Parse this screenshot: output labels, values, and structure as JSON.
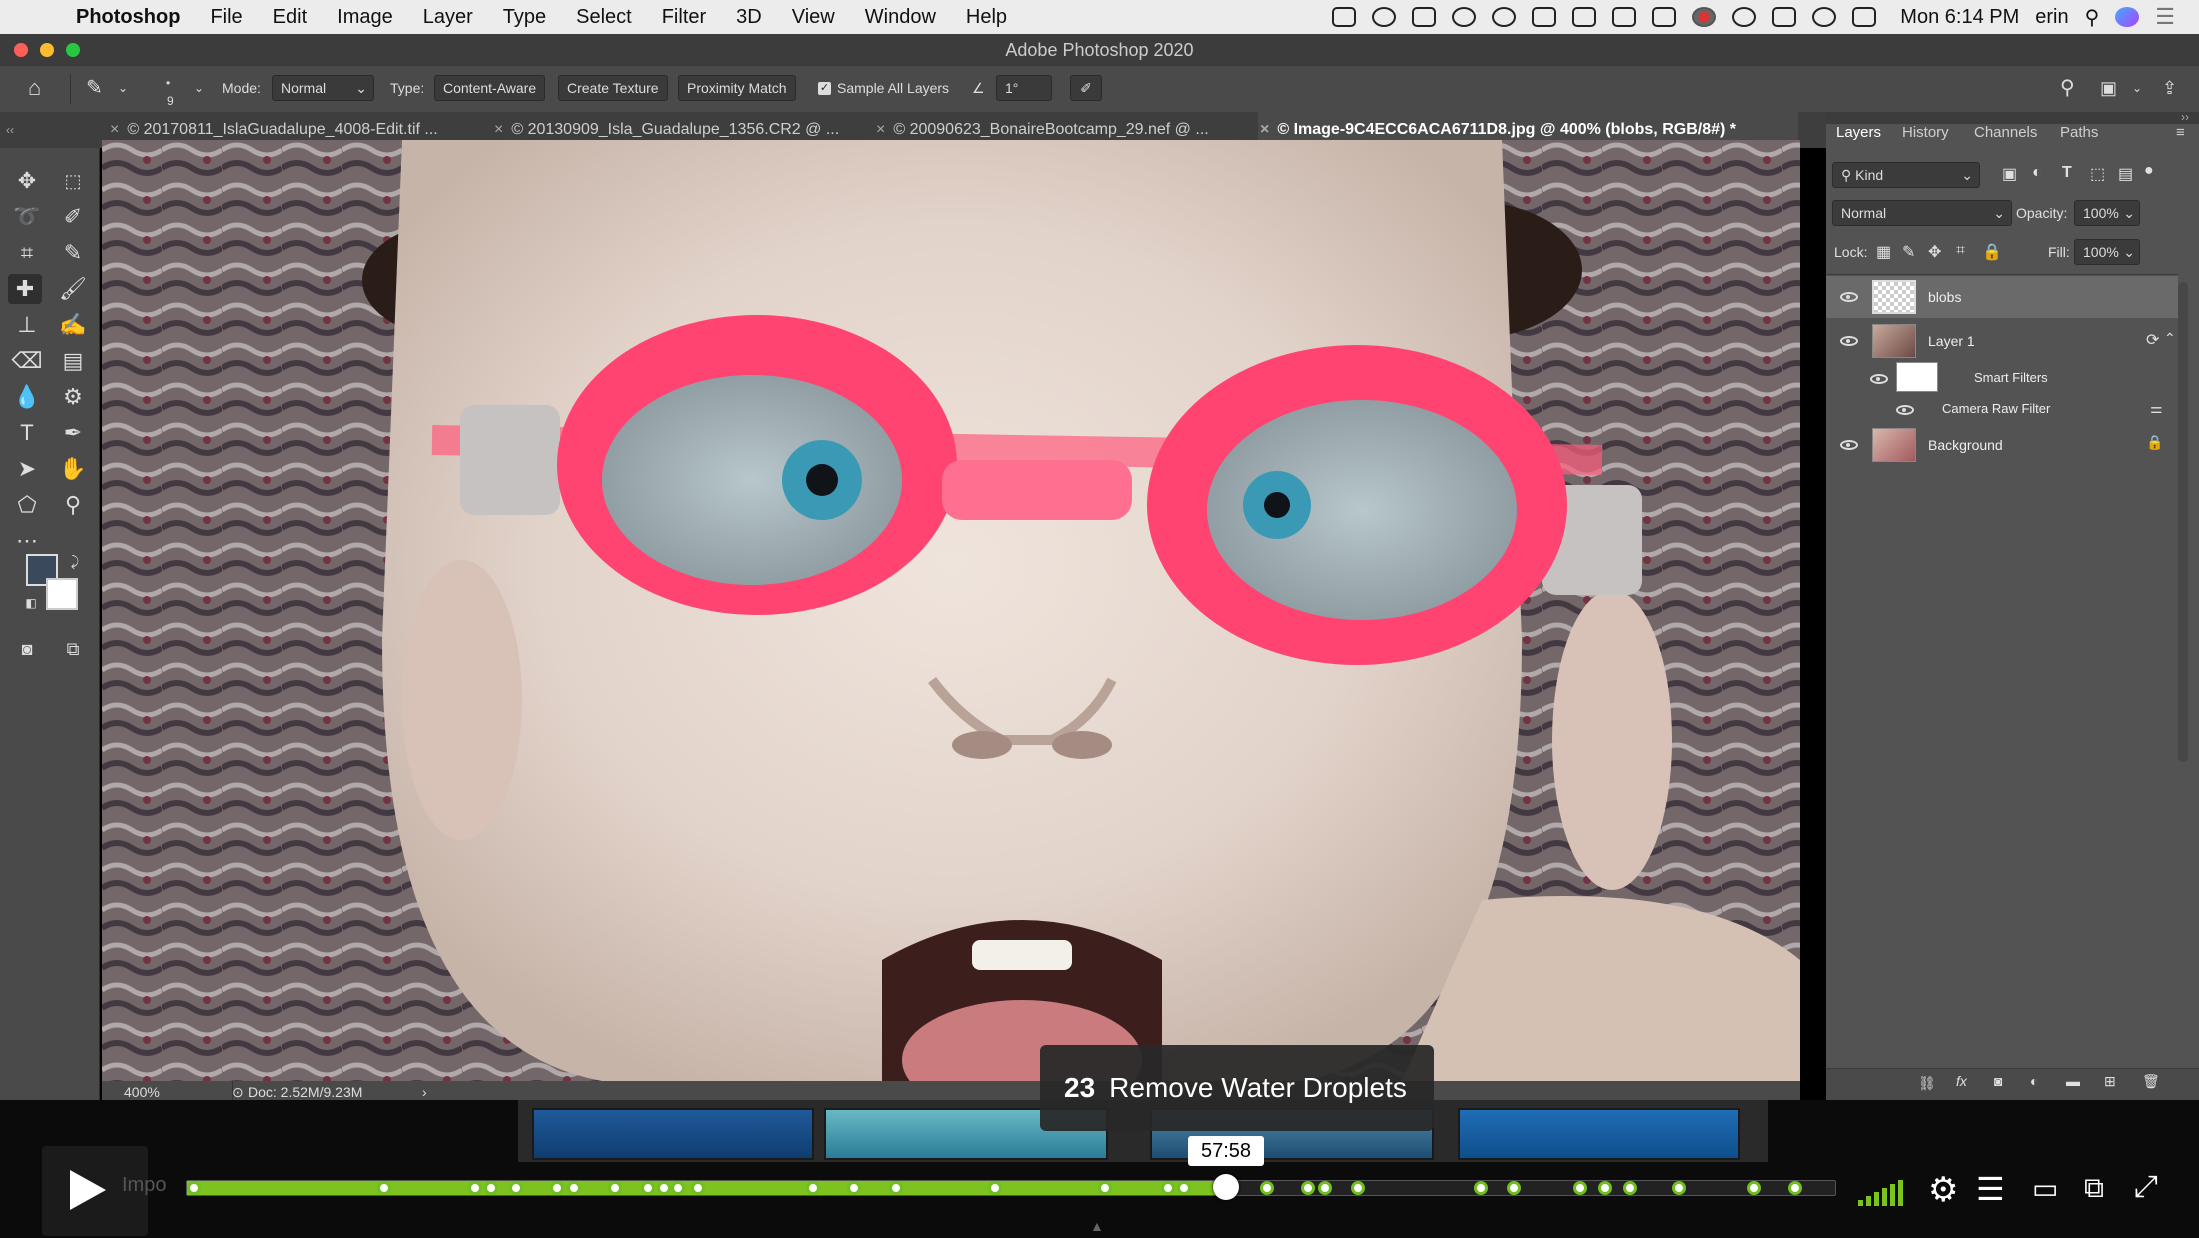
{
  "menubar": {
    "app_name": "Photoshop",
    "items": [
      "File",
      "Edit",
      "Image",
      "Layer",
      "Type",
      "Select",
      "Filter",
      "3D",
      "View",
      "Window",
      "Help"
    ],
    "clock": "Mon 6:14 PM",
    "user": "erin"
  },
  "window": {
    "title": "Adobe Photoshop 2020"
  },
  "options_bar": {
    "brush_size": "9",
    "mode_label": "Mode:",
    "mode_value": "Normal",
    "type_label": "Type:",
    "type_options": [
      "Content-Aware",
      "Create Texture",
      "Proximity Match"
    ],
    "sample_all_layers": "Sample All Layers",
    "angle_value": "1°"
  },
  "tabs": [
    "© 20170811_IslaGuadalupe_4008-Edit.tif ...",
    "© 20130909_Isla_Guadalupe_1356.CR2 @ ...",
    "© 20090623_BonaireBootcamp_29.nef @ ...",
    "© Image-9C4ECC6ACA6711D8.jpg @ 400% (blobs, RGB/8#) *"
  ],
  "status": {
    "zoom": "400%",
    "doc": "Doc: 2.52M/9.23M"
  },
  "layers_panel": {
    "tabs": [
      "Layers",
      "History",
      "Channels",
      "Paths"
    ],
    "filter_kind": "Kind",
    "blend_mode": "Normal",
    "opacity_label": "Opacity:",
    "opacity_value": "100%",
    "lock_label": "Lock:",
    "fill_label": "Fill:",
    "fill_value": "100%",
    "layers": {
      "blobs": "blobs",
      "layer1": "Layer 1",
      "smart_filters": "Smart Filters",
      "camera_raw": "Camera Raw Filter",
      "background": "Background"
    }
  },
  "video": {
    "chapter_number": "23",
    "chapter_title": "Remove Water Droplets",
    "timestamp": "57:58",
    "partial_label": "Impo",
    "progress": 0.63
  }
}
